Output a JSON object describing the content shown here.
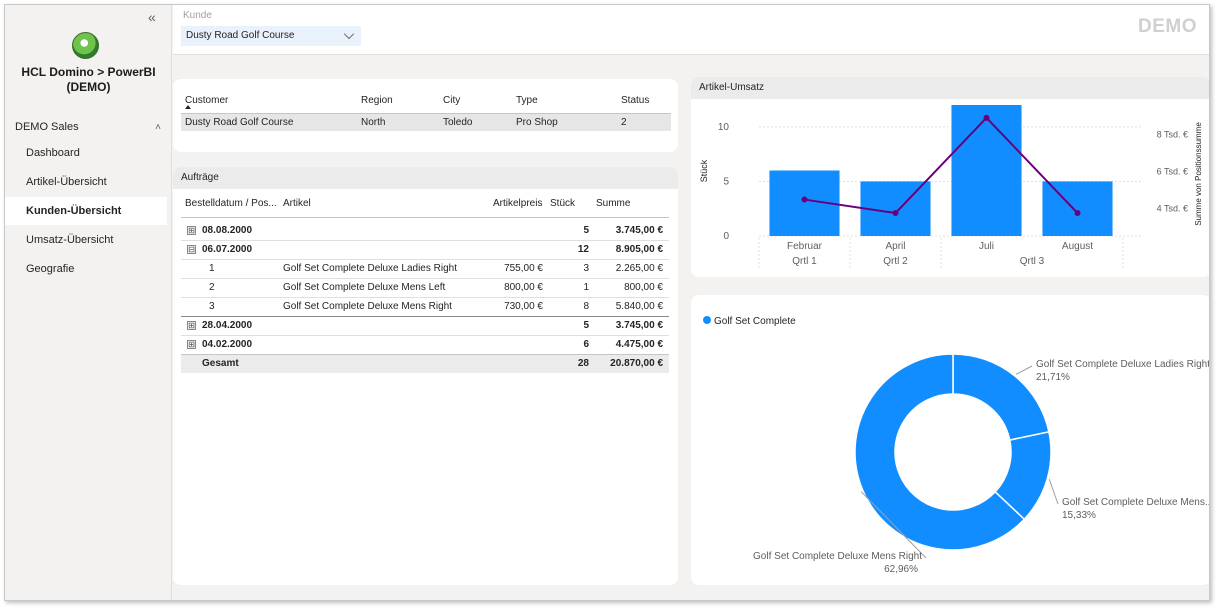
{
  "sidebar": {
    "title_line1": "HCL Domino > PowerBI",
    "title_line2": "(DEMO)",
    "section": "DEMO Sales",
    "items": [
      {
        "label": "Dashboard"
      },
      {
        "label": "Artikel-Übersicht"
      },
      {
        "label": "Kunden-Übersicht"
      },
      {
        "label": "Umsatz-Übersicht"
      },
      {
        "label": "Geografie"
      }
    ]
  },
  "filter": {
    "label": "Kunde",
    "value": "Dusty Road Golf Course"
  },
  "badge": "DEMO",
  "customer_table": {
    "headers": [
      "Customer",
      "Region",
      "City",
      "Type",
      "Status"
    ],
    "row": [
      "Dusty Road Golf Course",
      "North",
      "Toledo",
      "Pro Shop",
      "2"
    ]
  },
  "orders": {
    "title": "Aufträge",
    "headers": [
      "Bestelldatum / Pos...",
      "Artikel",
      "Artikelpreis",
      "Stück",
      "Summe"
    ],
    "groups": [
      {
        "expander": "⊞",
        "date": "08.08.2000",
        "qty": "5",
        "sum": "3.745,00 €"
      },
      {
        "expander": "⊟",
        "date": "06.07.2000",
        "qty": "12",
        "sum": "8.905,00 €"
      },
      {
        "expander": "⊞",
        "date": "28.04.2000",
        "qty": "5",
        "sum": "3.745,00 €"
      },
      {
        "expander": "⊞",
        "date": "04.02.2000",
        "qty": "6",
        "sum": "4.475,00 €"
      }
    ],
    "details": [
      {
        "pos": "1",
        "article": "Golf Set Complete Deluxe Ladies Right",
        "price": "755,00 €",
        "qty": "3",
        "sum": "2.265,00 €"
      },
      {
        "pos": "2",
        "article": "Golf Set Complete Deluxe Mens Left",
        "price": "800,00 €",
        "qty": "1",
        "sum": "800,00 €"
      },
      {
        "pos": "3",
        "article": "Golf Set Complete Deluxe Mens Right",
        "price": "730,00 €",
        "qty": "8",
        "sum": "5.840,00 €"
      }
    ],
    "total": {
      "label": "Gesamt",
      "qty": "28",
      "sum": "20.870,00 €"
    }
  },
  "chart_data": [
    {
      "type": "bar",
      "title": "Artikel-Umsatz",
      "categories": [
        "Februar",
        "April",
        "Juli",
        "August"
      ],
      "quarters": [
        "Qrtl 1",
        "Qrtl 2",
        "Qrtl 3"
      ],
      "ylabel": "Stück",
      "y2label": "Summe von Positionssumme",
      "ylim": [
        0,
        12
      ],
      "yticks": [
        "0",
        "5",
        "10"
      ],
      "y2ticks": [
        "4 Tsd. €",
        "6 Tsd. €",
        "8 Tsd. €"
      ],
      "y2lim": [
        2500,
        9600
      ],
      "series": [
        {
          "values": [
            6,
            5,
            12,
            5
          ],
          "color": "#118dff"
        },
        {
          "values": [
            4475,
            3745,
            8905,
            3745
          ],
          "color": "#6b007b"
        }
      ]
    },
    {
      "type": "pie",
      "legend": "Golf Set Complete",
      "labels": [
        "Golf Set Complete Deluxe Ladies Right",
        "Golf Set Complete Deluxe Mens...",
        "Golf Set Complete Deluxe Mens Right"
      ],
      "percent_labels": [
        "21,71%",
        "15,33%",
        "62,96%"
      ],
      "values": [
        21.71,
        15.33,
        62.96
      ],
      "color": "#118dff"
    }
  ]
}
